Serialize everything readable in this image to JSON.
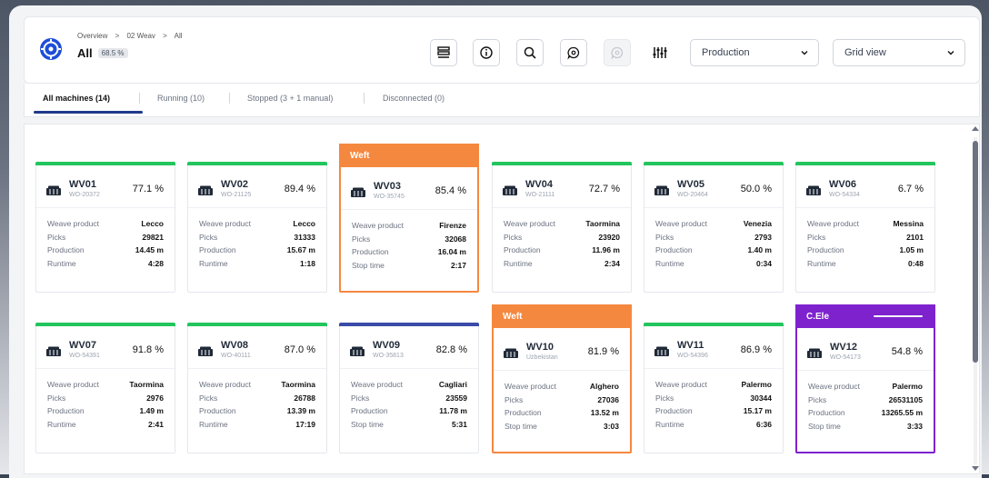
{
  "breadcrumb": [
    "Overview",
    "02 Weav",
    "All"
  ],
  "breadcrumb_sep": ">",
  "header": {
    "title": "All",
    "percentage": "68.5 %"
  },
  "selects": {
    "production": "Production",
    "view": "Grid view"
  },
  "tabs": [
    {
      "label": "All machines (14)"
    },
    {
      "label": "Running (10)"
    },
    {
      "label": "Stopped (3 + 1 manual)"
    },
    {
      "label": "Disconnected (0)"
    }
  ],
  "colors": {
    "running": "#22c55e",
    "weft": "#f5883f",
    "cele": "#7e22ce",
    "stopped_blue": "#3b4ba8"
  },
  "machines": [
    {
      "id": "WV01",
      "order": "WO-20372",
      "pct": "77.1 %",
      "product": "Lecco",
      "picks": "29821",
      "production": "14.45 m",
      "time_label": "Runtime",
      "time": "4:28"
    },
    {
      "id": "WV02",
      "order": "WO-21125",
      "pct": "89.4 %",
      "product": "Lecco",
      "picks": "31333",
      "production": "15.67 m",
      "time_label": "Runtime",
      "time": "1:18"
    },
    {
      "id": "WV03",
      "order": "WO-35745",
      "pct": "85.4 %",
      "product": "Firenze",
      "picks": "32068",
      "production": "16.04 m",
      "time_label": "Stop time",
      "time": "2:17",
      "banner": "Weft"
    },
    {
      "id": "WV04",
      "order": "WO-21111",
      "pct": "72.7 %",
      "product": "Taormina",
      "picks": "23920",
      "production": "11.96 m",
      "time_label": "Runtime",
      "time": "2:34"
    },
    {
      "id": "WV05",
      "order": "WO-20464",
      "pct": "50.0 %",
      "product": "Venezia",
      "picks": "2793",
      "production": "1.40 m",
      "time_label": "Runtime",
      "time": "0:34"
    },
    {
      "id": "WV06",
      "order": "WO-54334",
      "pct": "6.7 %",
      "product": "Messina",
      "picks": "2101",
      "production": "1.05 m",
      "time_label": "Runtime",
      "time": "0:48"
    },
    {
      "id": "WV07",
      "order": "WO-54391",
      "pct": "91.8 %",
      "product": "Taormina",
      "picks": "2976",
      "production": "1.49 m",
      "time_label": "Runtime",
      "time": "2:41"
    },
    {
      "id": "WV08",
      "order": "WO-40111",
      "pct": "87.0 %",
      "product": "Taormina",
      "picks": "26788",
      "production": "13.39 m",
      "time_label": "Runtime",
      "time": "17:19"
    },
    {
      "id": "WV09",
      "order": "WO-35813",
      "pct": "82.8 %",
      "product": "Cagliari",
      "picks": "23559",
      "production": "11.78 m",
      "time_label": "Stop time",
      "time": "5:31"
    },
    {
      "id": "WV10",
      "order": "Uzbekistan",
      "pct": "81.9 %",
      "product": "Alghero",
      "picks": "27036",
      "production": "13.52 m",
      "time_label": "Stop time",
      "time": "3:03",
      "banner": "Weft"
    },
    {
      "id": "WV11",
      "order": "WO-54396",
      "pct": "86.9 %",
      "product": "Palermo",
      "picks": "30344",
      "production": "15.17 m",
      "time_label": "Runtime",
      "time": "6:36"
    },
    {
      "id": "WV12",
      "order": "WO-54173",
      "pct": "54.8 %",
      "product": "Palermo",
      "picks": "26531105",
      "production": "13265.55 m",
      "time_label": "Stop time",
      "time": "3:33",
      "banner": "C.Ele"
    }
  ],
  "labels": {
    "product": "Weave product",
    "picks": "Picks",
    "production": "Production"
  }
}
